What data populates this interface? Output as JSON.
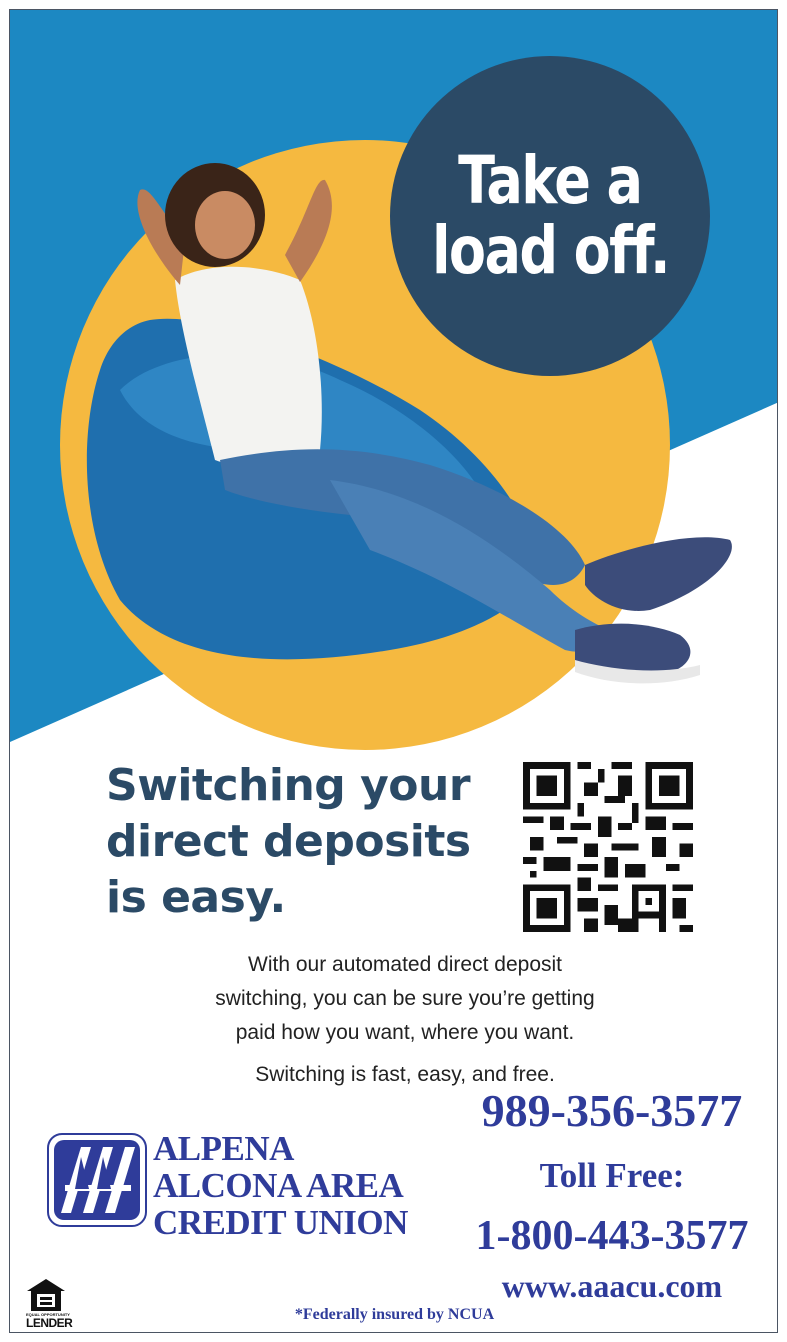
{
  "hero": {
    "badge_line1": "Take a",
    "badge_line2": "load off.",
    "photo": "woman-relaxing-in-blue-beanbag-chair"
  },
  "headline": {
    "line1": "Switching your",
    "line2": "direct deposits",
    "line3": "is easy."
  },
  "qr_code": "qr-code",
  "body": {
    "line1": "With our automated direct deposit",
    "line2": "switching, you can be sure you’re getting",
    "line3": "paid how you want, where you want.",
    "line4": "Switching is fast, easy, and free."
  },
  "credit_union": {
    "logo": "aaa-logo",
    "name_line1": "ALPENA",
    "name_line2": "ALCONA AREA",
    "name_line3": "CREDIT UNION"
  },
  "contact": {
    "phone": "989-356-3577",
    "toll_free_label": "Toll Free:",
    "toll_free_number": "1-800-443-3577",
    "website": "www.aaacu.com"
  },
  "equal_housing": {
    "icon": "equal-housing-house-icon",
    "line_small": "EQUAL OPPORTUNITY",
    "line_large": "LENDER"
  },
  "disclaimer": "*Federally insured by NCUA",
  "colors": {
    "sky_blue": "#1c88c2",
    "sun_yellow": "#f5b940",
    "navy": "#2b4a66",
    "brand_blue": "#2f3c9a"
  }
}
